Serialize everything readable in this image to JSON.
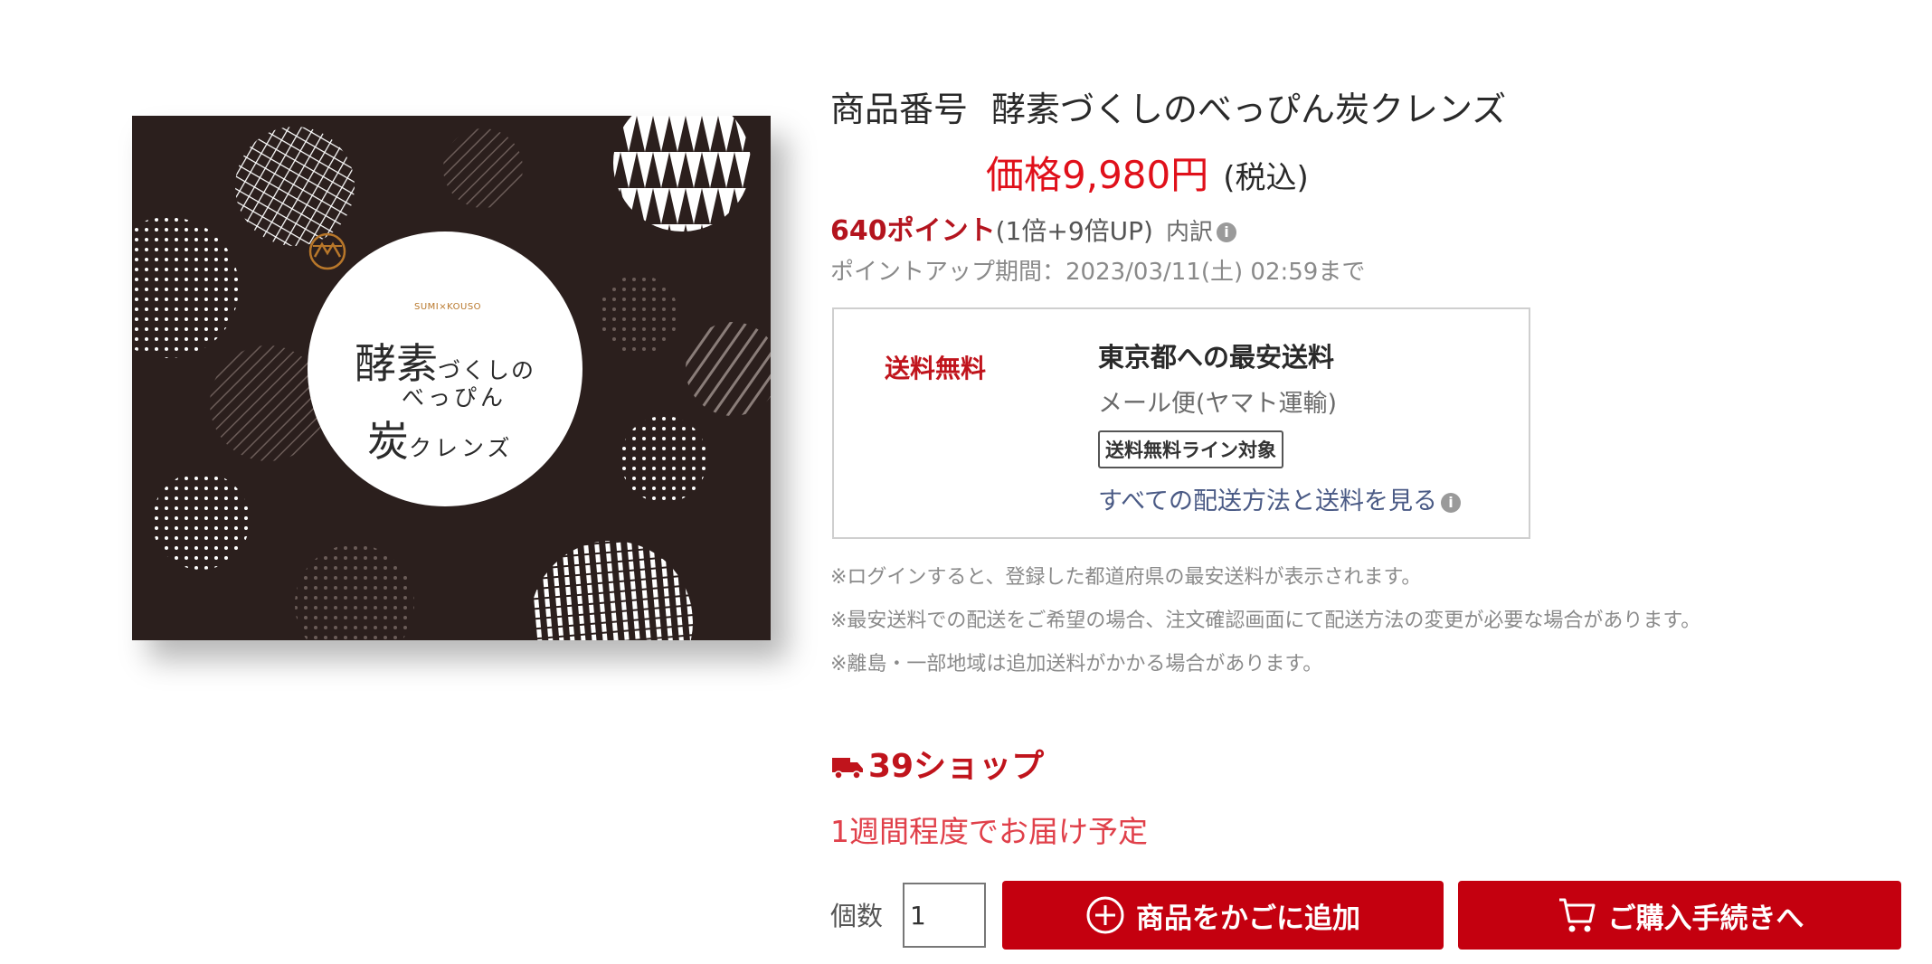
{
  "product": {
    "image_alt": "product-package",
    "package_logo_text": "SUMI×KOUSO",
    "package_line1_big": "酵素",
    "package_line1_small": "づくしの",
    "package_line2": "べっぴん",
    "package_line3_big": "炭",
    "package_line3_small": "クレンズ",
    "title_label": "商品番号",
    "title": "酵素づくしのべっぴん炭クレンズ",
    "price": "価格9,980円",
    "tax": "(税込)",
    "points": "640ポイント",
    "points_detail": "(1倍+9倍UP)",
    "points_breakdown": "内訳",
    "points_period": "ポイントアップ期間：2023/03/11(土) 02:59まで"
  },
  "shipping": {
    "free_label": "送料無料",
    "title": "東京都への最安送料",
    "method": "メール便(ヤマト運輸)",
    "badge": "送料無料ライン対象",
    "link": "すべての配送方法と送料を見る"
  },
  "notes": [
    "※ログインすると、登録した都道府県の最安送料が表示されます。",
    "※最安送料での配送をご希望の場合、注文確認画面にて配送方法の変更が必要な場合があります。",
    "※離島・一部地域は追加送料がかかる場合があります。"
  ],
  "shop": {
    "name": "39ショップ",
    "delivery": "1週間程度でお届け予定"
  },
  "purchase": {
    "qty_label": "個数",
    "qty_value": "1",
    "add_cart": "商品をかごに追加",
    "checkout": "ご購入手続きへ"
  },
  "colors": {
    "accent_red": "#c4000f",
    "price_red": "#e0101a",
    "package_dark": "#2b1f1d"
  }
}
